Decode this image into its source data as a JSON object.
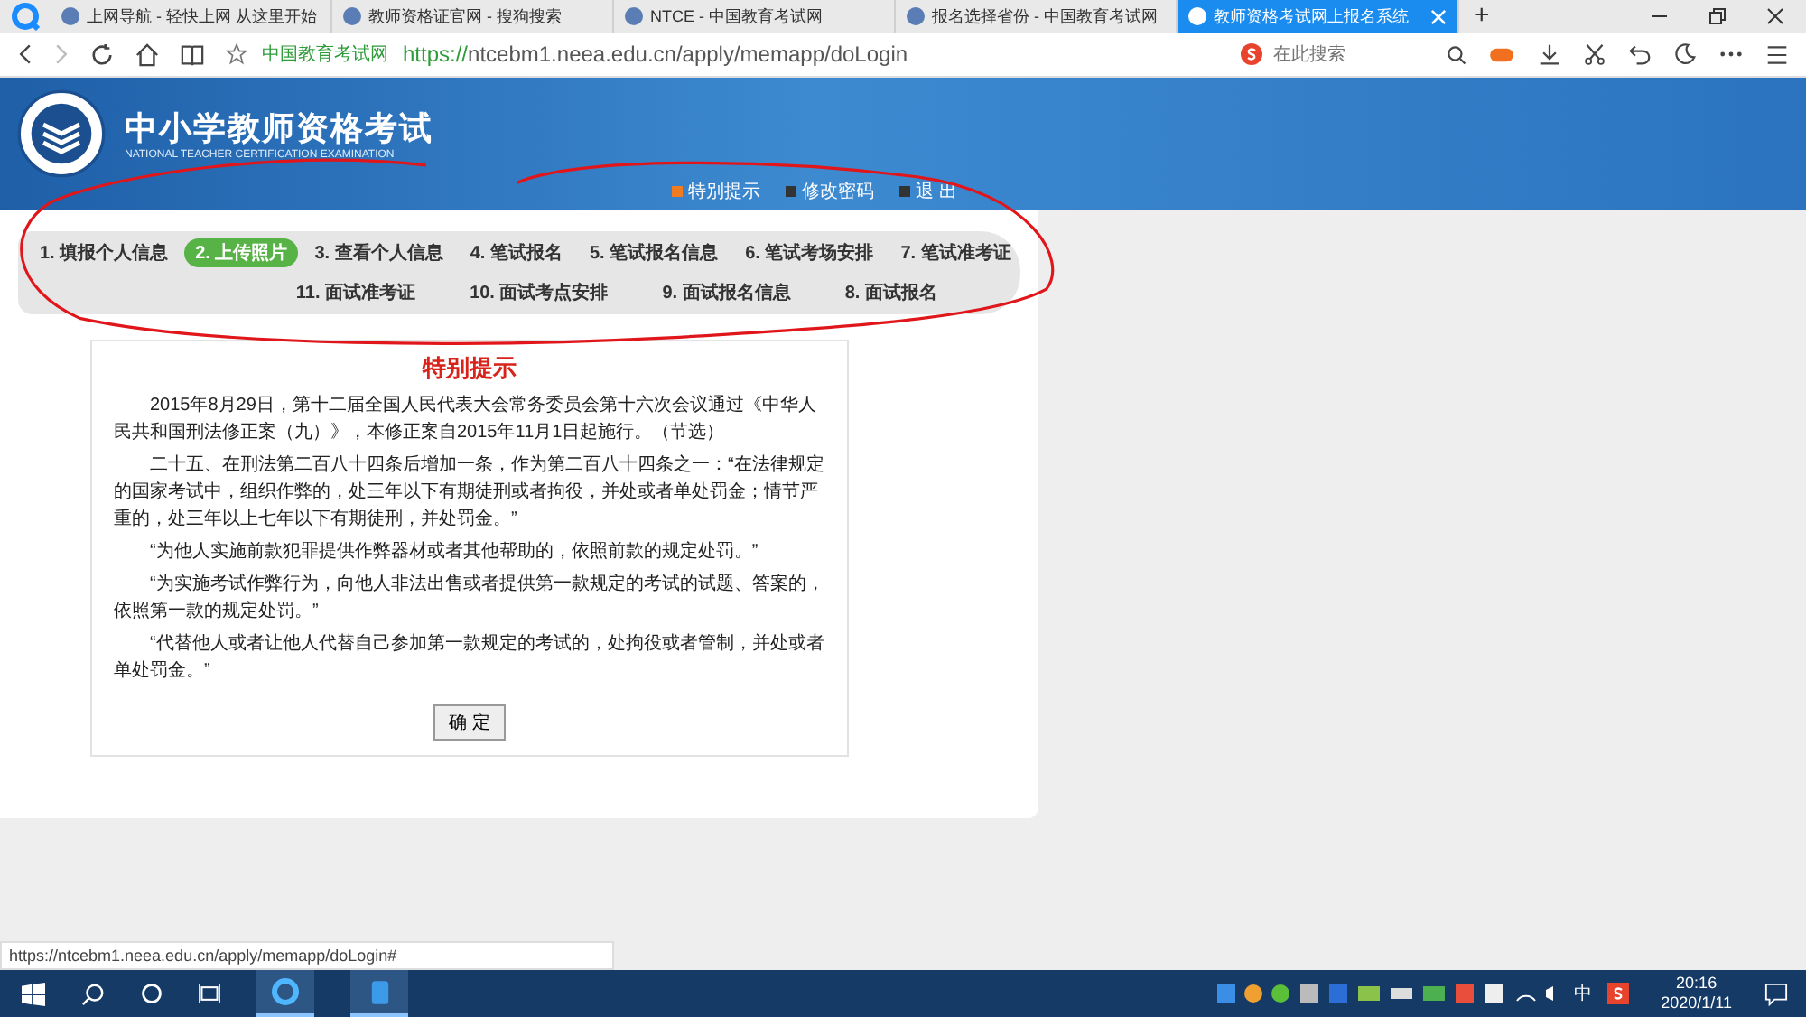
{
  "browser_tabs": [
    {
      "title": "上网导航 - 轻快上网 从这里开始",
      "selected": false
    },
    {
      "title": "教师资格证官网 - 搜狗搜索",
      "selected": false
    },
    {
      "title": "NTCE - 中国教育考试网",
      "selected": false
    },
    {
      "title": "报名选择省份 - 中国教育考试网",
      "selected": false
    },
    {
      "title": "教师资格考试网上报名系统",
      "selected": true
    }
  ],
  "new_tab": "+",
  "address_bar": {
    "site_name": "中国教育考试网",
    "url_scheme": "https://",
    "url_rest": "ntcebm1.neea.edu.cn/apply/memapp/doLogin"
  },
  "search": {
    "placeholder": "在此搜索"
  },
  "header": {
    "title": "中小学教师资格考试",
    "subtitle": "NATIONAL TEACHER CERTIFICATION EXAMINATION",
    "links": [
      "特别提示",
      "修改密码",
      "退 出"
    ]
  },
  "steps_row_1": [
    {
      "label": "1. 填报个人信息",
      "selected": false
    },
    {
      "label": "2. 上传照片",
      "selected": true
    },
    {
      "label": "3. 查看个人信息",
      "selected": false
    },
    {
      "label": "4. 笔试报名",
      "selected": false
    },
    {
      "label": "5. 笔试报名信息",
      "selected": false
    },
    {
      "label": "6. 笔试考场安排",
      "selected": false
    },
    {
      "label": "7. 笔试准考证",
      "selected": false
    }
  ],
  "steps_row_2": [
    {
      "label": "11. 面试准考证",
      "selected": false
    },
    {
      "label": "10. 面试考点安排",
      "selected": false
    },
    {
      "label": "9. 面试报名信息",
      "selected": false
    },
    {
      "label": "8. 面试报名",
      "selected": false
    }
  ],
  "notice": {
    "title": "特别提示",
    "paragraphs": [
      "2015年8月29日，第十二届全国人民代表大会常务委员会第十六次会议通过《中华人民共和国刑法修正案（九）》，本修正案自2015年11月1日起施行。（节选）",
      "二十五、在刑法第二百八十四条后增加一条，作为第二百八十四条之一：“在法律规定的国家考试中，组织作弊的，处三年以下有期徒刑或者拘役，并处或者单处罚金；情节严重的，处三年以上七年以下有期徒刑，并处罚金。”",
      "“为他人实施前款犯罪提供作弊器材或者其他帮助的，依照前款的规定处罚。”",
      "“为实施考试作弊行为，向他人非法出售或者提供第一款规定的考试的试题、答案的，依照第一款的规定处罚。”",
      "“代替他人或者让他人代替自己参加第一款规定的考试的，处拘役或者管制，并处或者单处罚金。”"
    ],
    "button": "确 定"
  },
  "status_url": "https://ntcebm1.neea.edu.cn/apply/memapp/doLogin#",
  "taskbar": {
    "ime": "中",
    "time": "20:16",
    "date": "2020/1/11"
  }
}
